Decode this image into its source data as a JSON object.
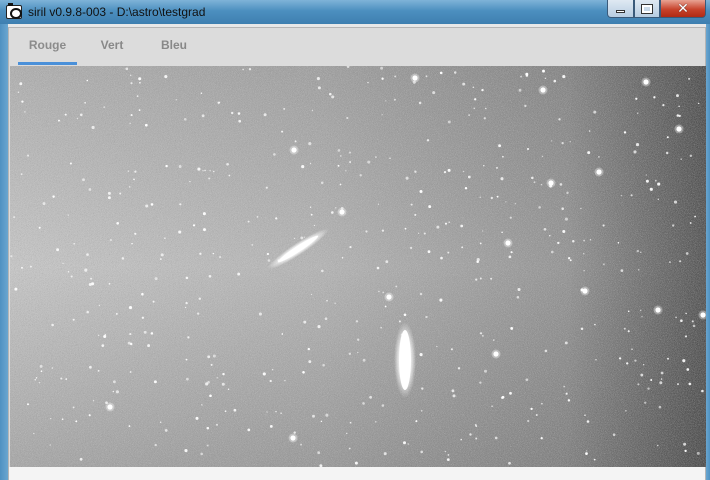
{
  "window": {
    "title": "siril v0.9.8-003 - D:\\astro\\testgrad",
    "icon": "camera-icon",
    "controls": {
      "minimize_icon": "minimize-icon",
      "maximize_icon": "maximize-icon",
      "close_icon": "close-icon",
      "close_glyph": "✕"
    }
  },
  "tabs": [
    {
      "label": "Rouge",
      "active": true
    },
    {
      "label": "Vert",
      "active": false
    },
    {
      "label": "Bleu",
      "active": false
    }
  ],
  "colors": {
    "accent": "#4a90d9",
    "titlebar": "#4c8fbf",
    "close_button": "#c7432c"
  }
}
